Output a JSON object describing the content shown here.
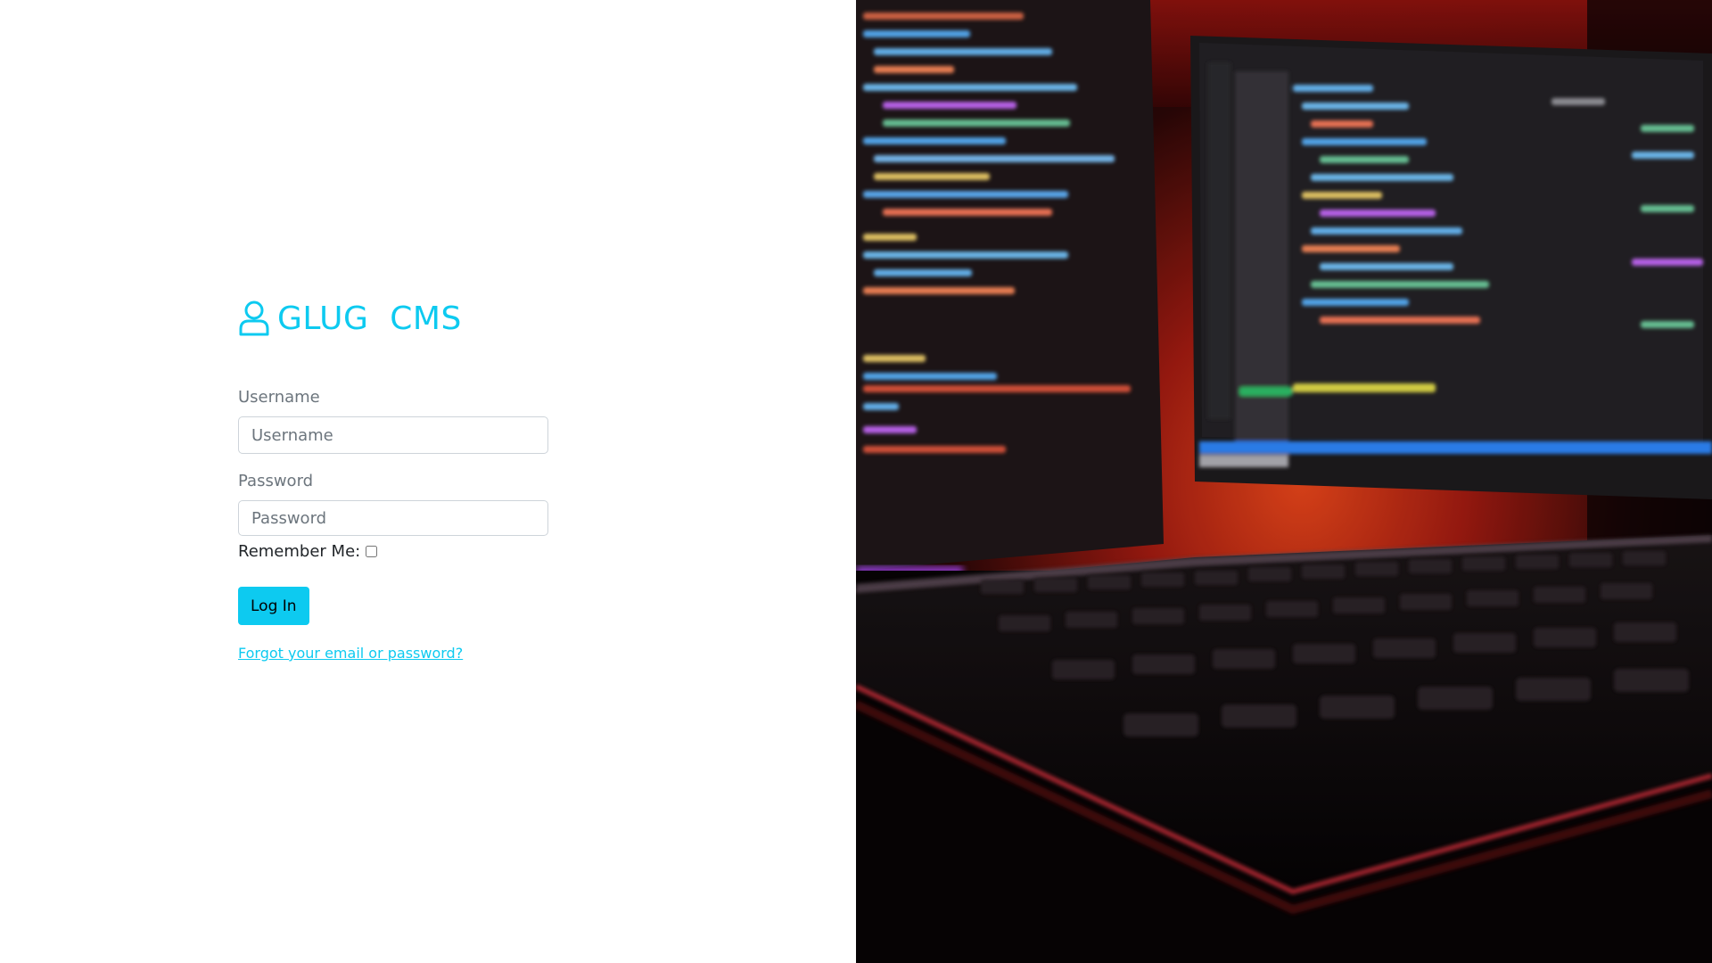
{
  "brand": {
    "title": "GLUG  CMS",
    "icon": "user-icon",
    "color": "#0dcaf0"
  },
  "form": {
    "username_label": "Username",
    "username_placeholder": "Username",
    "username_value": "",
    "password_label": "Password",
    "password_placeholder": "Password",
    "password_value": "",
    "remember_label": "Remember Me:",
    "remember_checked": false,
    "submit_label": "Log In",
    "forgot_link": "Forgot your email or password?"
  },
  "hero_image": {
    "subject": "code-on-monitors-with-backlit-keyboard"
  }
}
